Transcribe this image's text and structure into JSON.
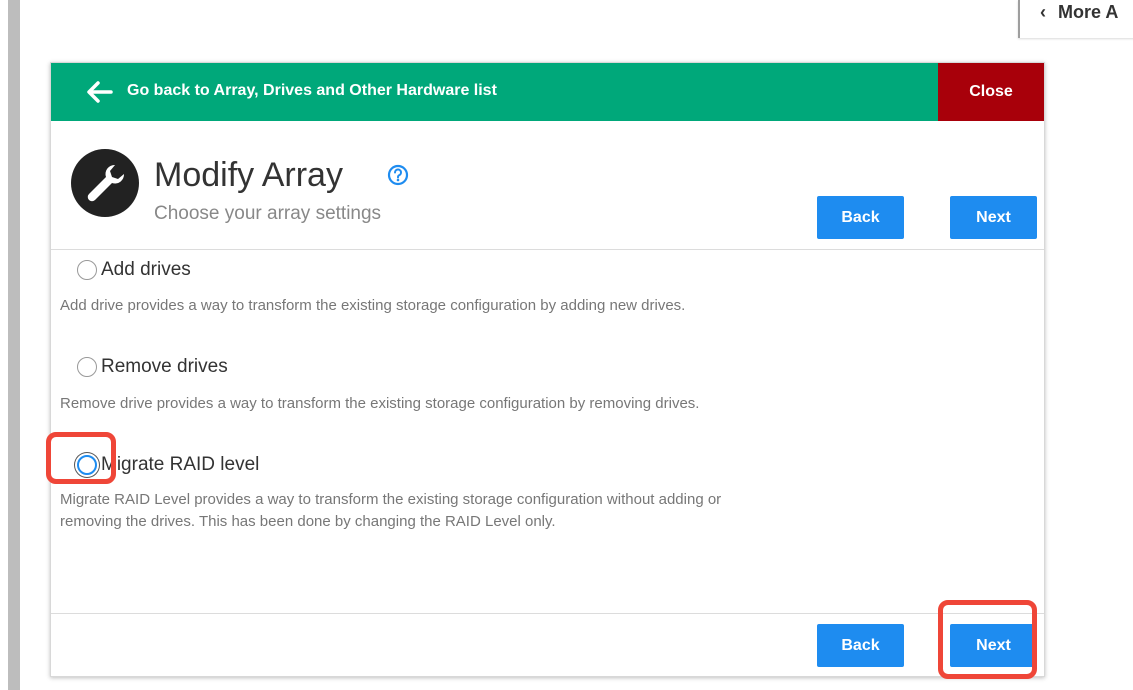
{
  "more_tab": {
    "label": "More A"
  },
  "topbar": {
    "back_label": "Go back to Array, Drives and Other Hardware list",
    "close_label": "Close"
  },
  "header": {
    "title": "Modify Array",
    "subtitle": "Choose your array settings"
  },
  "buttons": {
    "back": "Back",
    "next": "Next"
  },
  "options": [
    {
      "label": "Add drives",
      "description": "Add drive provides a way to transform the existing storage configuration by adding new drives.",
      "selected": false
    },
    {
      "label": "Remove drives",
      "description": "Remove drive provides a way to transform the existing storage configuration by removing drives.",
      "selected": false
    },
    {
      "label": "Migrate RAID level",
      "description": "Migrate RAID Level provides a way to transform the existing storage configuration without adding or removing the drives. This has been done by changing the RAID Level only.",
      "selected": true
    }
  ],
  "colors": {
    "topbar": "#00a87a",
    "close": "#a8000a",
    "primary_button": "#1e8cf0",
    "highlight": "#ef4638"
  },
  "icons": [
    "back-arrow-icon",
    "wrench-icon",
    "help-icon",
    "chevron-left-icon"
  ]
}
